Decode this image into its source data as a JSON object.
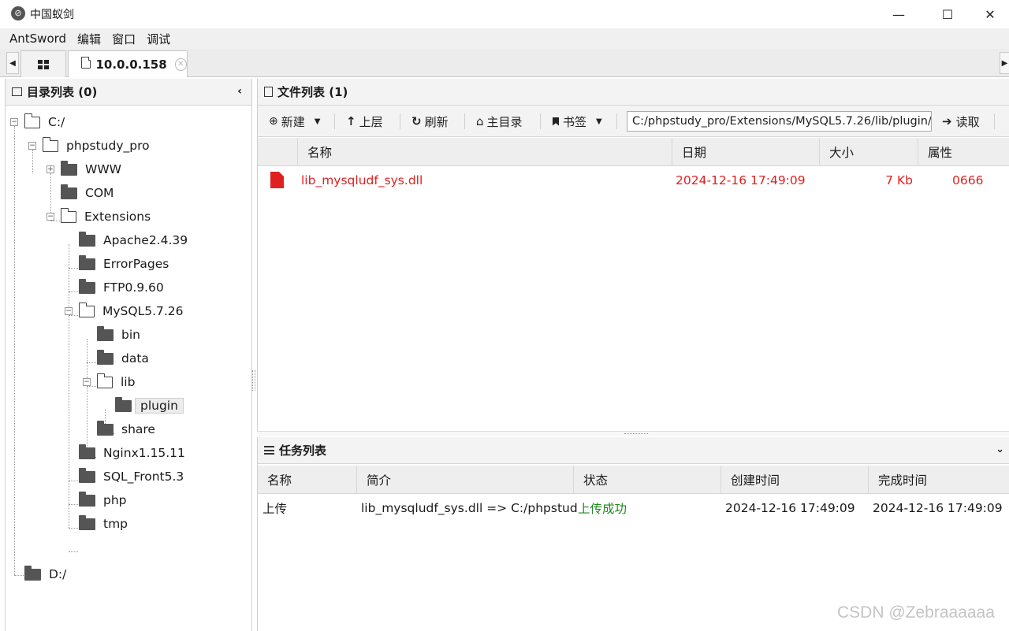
{
  "window": {
    "title": "中国蚁剑",
    "minimize": "—",
    "maximize": "☐",
    "close": "✕"
  },
  "menu": [
    "AntSword",
    "编辑",
    "窗口",
    "调试"
  ],
  "tabs": {
    "session_label": "10.0.0.158"
  },
  "dir_panel": {
    "title": "目录列表 (0)",
    "tree": {
      "c": "C:/",
      "phpstudy_pro": "phpstudy_pro",
      "www": "WWW",
      "com": "COM",
      "extensions": "Extensions",
      "apache": "Apache2.4.39",
      "errorpages": "ErrorPages",
      "ftp": "FTP0.9.60",
      "mysql": "MySQL5.7.26",
      "bin": "bin",
      "data": "data",
      "lib": "lib",
      "plugin": "plugin",
      "share": "share",
      "nginx": "Nginx1.15.11",
      "sqlfront": "SQL_Front5.3",
      "php": "php",
      "tmp": "tmp",
      "d": "D:/"
    }
  },
  "file_panel": {
    "title": "文件列表 (1)",
    "toolbar": {
      "new": "新建",
      "up": "上层",
      "refresh": "刷新",
      "home": "主目录",
      "bookmark": "书签",
      "path": "C:/phpstudy_pro/Extensions/MySQL5.7.26/lib/plugin/",
      "read": "读取"
    },
    "columns": {
      "name": "名称",
      "date": "日期",
      "size": "大小",
      "attr": "属性"
    },
    "files": [
      {
        "name": "lib_mysqludf_sys.dll",
        "date": "2024-12-16 17:49:09",
        "size": "7 Kb",
        "attr": "0666"
      }
    ]
  },
  "task_panel": {
    "title": "任务列表",
    "columns": {
      "name": "名称",
      "desc": "简介",
      "status": "状态",
      "created": "创建时间",
      "finished": "完成时间"
    },
    "tasks": [
      {
        "name": "上传",
        "desc": "lib_mysqludf_sys.dll => C:/phpstudy_",
        "status": "上传成功",
        "created": "2024-12-16 17:49:09",
        "finished": "2024-12-16 17:49:09"
      }
    ]
  },
  "watermark": "CSDN @Zebraaaaaa"
}
